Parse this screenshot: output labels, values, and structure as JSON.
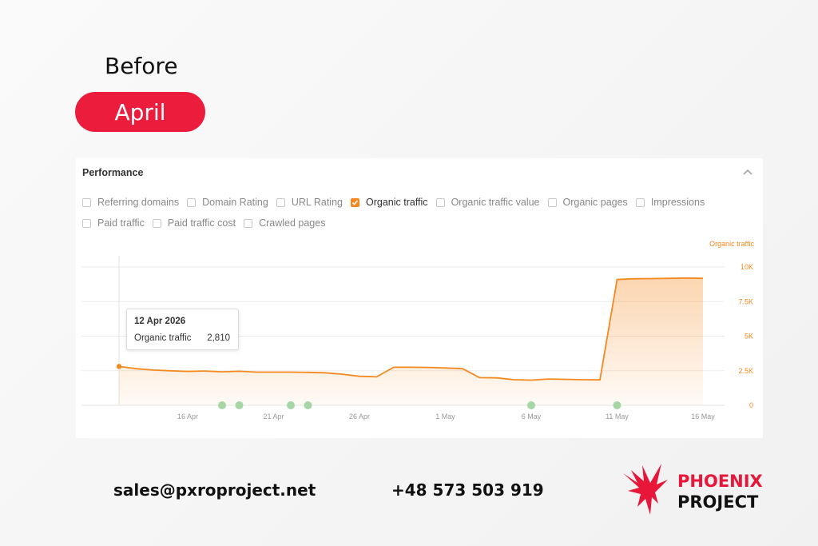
{
  "header": {
    "before_label": "Before",
    "period_pill": "April"
  },
  "panel": {
    "title": "Performance",
    "filters_row1": [
      {
        "label": "Referring domains",
        "checked": false
      },
      {
        "label": "Domain Rating",
        "checked": false
      },
      {
        "label": "URL Rating",
        "checked": false
      },
      {
        "label": "Organic traffic",
        "checked": true
      },
      {
        "label": "Organic traffic value",
        "checked": false
      },
      {
        "label": "Organic pages",
        "checked": false
      },
      {
        "label": "Impressions",
        "checked": false
      }
    ],
    "filters_row2": [
      {
        "label": "Paid traffic",
        "checked": false
      },
      {
        "label": "Paid traffic cost",
        "checked": false
      },
      {
        "label": "Crawled pages",
        "checked": false
      }
    ]
  },
  "tooltip": {
    "date": "12 Apr 2026",
    "label": "Organic traffic",
    "value": "2,810"
  },
  "chart_data": {
    "type": "area",
    "series": [
      {
        "name": "Organic traffic",
        "color": "#f5891f",
        "x": [
          "12 Apr",
          "13 Apr",
          "14 Apr",
          "15 Apr",
          "16 Apr",
          "17 Apr",
          "18 Apr",
          "19 Apr",
          "20 Apr",
          "21 Apr",
          "22 Apr",
          "23 Apr",
          "24 Apr",
          "25 Apr",
          "26 Apr",
          "27 Apr",
          "28 Apr",
          "29 Apr",
          "30 Apr",
          "1 May",
          "2 May",
          "3 May",
          "4 May",
          "5 May",
          "6 May",
          "7 May",
          "8 May",
          "9 May",
          "10 May",
          "11 May",
          "12 May",
          "13 May",
          "14 May",
          "15 May",
          "16 May"
        ],
        "values": [
          2810,
          2650,
          2550,
          2500,
          2450,
          2480,
          2420,
          2460,
          2400,
          2400,
          2400,
          2380,
          2350,
          2250,
          2100,
          2060,
          2750,
          2750,
          2740,
          2700,
          2650,
          2000,
          1980,
          1850,
          1820,
          1900,
          1880,
          1850,
          1840,
          9100,
          9150,
          9160,
          9180,
          9200,
          9180
        ]
      }
    ],
    "annotations_x": [
      "18 Apr",
      "19 Apr",
      "22 Apr",
      "23 Apr",
      "6 May",
      "11 May"
    ],
    "x_ticks": [
      "16 Apr",
      "21 Apr",
      "26 Apr",
      "1 May",
      "6 May",
      "11 May",
      "16 May"
    ],
    "y_ticks": [
      "0",
      "2.5K",
      "5K",
      "7.5K",
      "10K"
    ],
    "y_axis_title": "Organic traffic",
    "ylim": [
      0,
      10000
    ],
    "grid": true,
    "legend": "none"
  },
  "footer": {
    "email": "sales@pxroproject.net",
    "phone": "+48 573 503 919",
    "logo_line1": "PHOENIX",
    "logo_line2": "PROJECT"
  },
  "colors": {
    "accent": "#ec1c3d",
    "series": "#f5891f",
    "annotation_dot": "#a6d6a6"
  },
  "icons": {
    "collapse": "chevron-up-icon",
    "checkbox_checked": "check-icon",
    "logo": "phoenix-bird-icon"
  }
}
